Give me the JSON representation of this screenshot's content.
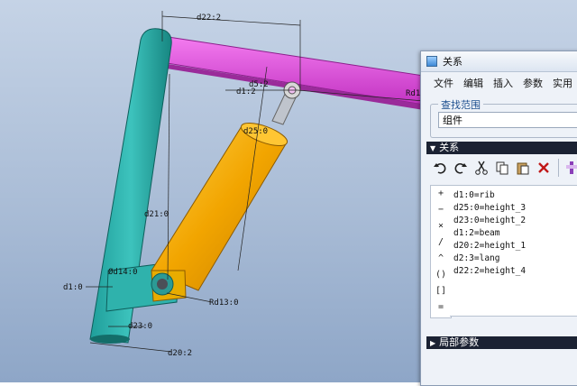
{
  "model": {
    "dimensions": {
      "d22": "d22:2",
      "d5": "d5:2",
      "rd1": "Rd1",
      "d1": "d1:2",
      "d25": "d25:0",
      "d21": "d21:0",
      "d14": "Ød14:0",
      "d1b": "d1:0",
      "d23": "d23:0",
      "rd13": "Rd13:0",
      "d20": "d20:2"
    }
  },
  "dialog": {
    "title": "关系",
    "menu": [
      "文件",
      "编辑",
      "插入",
      "参数",
      "实用"
    ],
    "scope_label": "查找范围",
    "scope_value": "组件",
    "relations_label": "关系",
    "local_params_label": "局部参数",
    "operators": [
      "+",
      "−",
      "×",
      "/",
      "^",
      "()",
      "[]",
      "="
    ],
    "relations": [
      "d1:0=rib",
      "d25:0=height_3",
      "d23:0=height_2",
      "d1:2=beam",
      "d20:2=height_1",
      "d2:3=lang",
      "d22:2=height_4"
    ]
  }
}
